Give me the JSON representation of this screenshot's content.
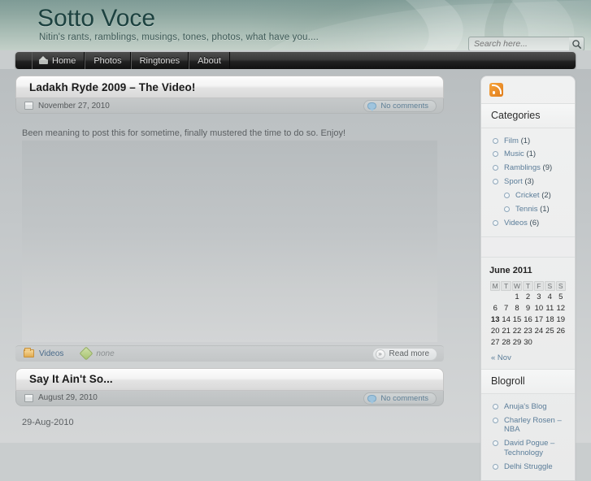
{
  "header": {
    "site_title": "Sotto Voce",
    "tagline": "Nitin's rants, ramblings, musings, tones, photos, what have you....",
    "search_placeholder": "Search here...",
    "search_value": "",
    "accent_green": "#8fa8a1",
    "title_color": "#1d4240"
  },
  "nav": {
    "items": [
      {
        "label": "Home",
        "icon": "home-icon"
      },
      {
        "label": "Photos",
        "icon": ""
      },
      {
        "label": "Ringtones",
        "icon": ""
      },
      {
        "label": "About",
        "icon": ""
      }
    ]
  },
  "posts": [
    {
      "title": "Ladakh Ryde 2009 – The Video!",
      "date": "November 27, 2010",
      "comments": "No comments",
      "body": "Been meaning to post this for sometime, finally mustered the time to do so. Enjoy!",
      "category": "Videos",
      "tags": "none",
      "read_more": "Read more"
    },
    {
      "title": "Say It Ain't So...",
      "date": "August 29, 2010",
      "comments": "No comments",
      "body": "29-Aug-2010"
    }
  ],
  "sidebar": {
    "rss_icon": "rss-icon",
    "categories": {
      "title": "Categories",
      "items": [
        {
          "label": "Film",
          "count": "(1)",
          "sub": false
        },
        {
          "label": "Music",
          "count": "(1)",
          "sub": false
        },
        {
          "label": "Ramblings",
          "count": "(9)",
          "sub": false
        },
        {
          "label": "Sport",
          "count": "(3)",
          "sub": false
        },
        {
          "label": "Cricket",
          "count": "(2)",
          "sub": true
        },
        {
          "label": "Tennis",
          "count": "(1)",
          "sub": true
        },
        {
          "label": "Videos",
          "count": "(6)",
          "sub": false
        }
      ]
    },
    "calendar": {
      "caption": "June 2011",
      "weekdays": [
        "M",
        "T",
        "W",
        "T",
        "F",
        "S",
        "S"
      ],
      "weeks": [
        [
          "",
          "",
          "1",
          "2",
          "3",
          "4",
          "5"
        ],
        [
          "6",
          "7",
          "8",
          "9",
          "10",
          "11",
          "12"
        ],
        [
          "13",
          "14",
          "15",
          "16",
          "17",
          "18",
          "19"
        ],
        [
          "20",
          "21",
          "22",
          "23",
          "24",
          "25",
          "26"
        ],
        [
          "27",
          "28",
          "29",
          "30",
          "",
          "",
          ""
        ]
      ],
      "today": "13",
      "prev_link": "« Nov"
    },
    "blogroll": {
      "title": "Blogroll",
      "items": [
        {
          "label": "Anuja's Blog"
        },
        {
          "label": "Charley Rosen – NBA"
        },
        {
          "label": "David Pogue – Technology"
        },
        {
          "label": "Delhi Struggle"
        }
      ]
    }
  }
}
